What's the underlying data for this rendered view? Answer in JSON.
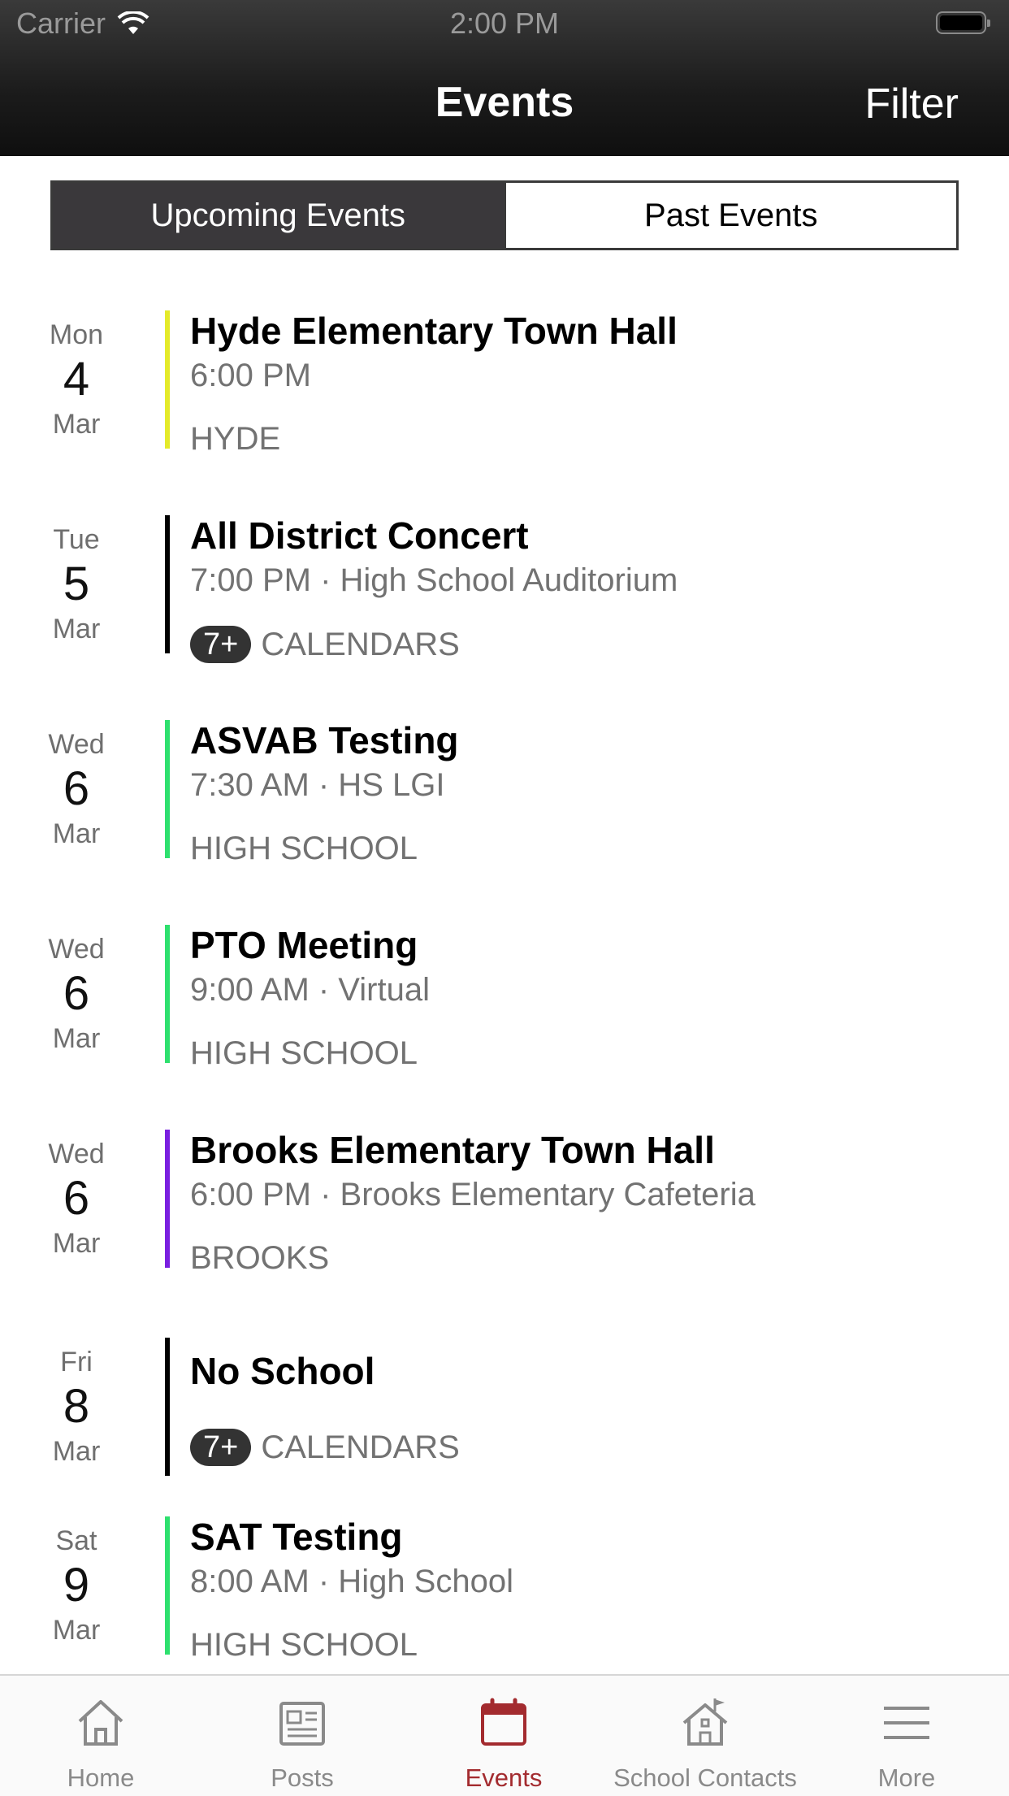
{
  "status_bar": {
    "carrier": "Carrier",
    "time": "2:00 PM"
  },
  "header": {
    "title": "Events",
    "filter": "Filter"
  },
  "segments": {
    "upcoming": "Upcoming Events",
    "past": "Past Events"
  },
  "events": [
    {
      "dow": "Mon",
      "day": "4",
      "month": "Mar",
      "title": "Hyde Elementary Town Hall",
      "time": "6:00 PM",
      "calendar": "HYDE",
      "badge": "",
      "color": "#e4ea2a"
    },
    {
      "dow": "Tue",
      "day": "5",
      "month": "Mar",
      "title": "All District Concert",
      "time": "7:00 PM · High School Auditorium",
      "calendar": "CALENDARS",
      "badge": "7+",
      "color": "#000000"
    },
    {
      "dow": "Wed",
      "day": "6",
      "month": "Mar",
      "title": "ASVAB Testing",
      "time": "7:30 AM · HS LGI",
      "calendar": "HIGH SCHOOL",
      "badge": "",
      "color": "#2ee06e"
    },
    {
      "dow": "Wed",
      "day": "6",
      "month": "Mar",
      "title": "PTO Meeting",
      "time": "9:00 AM · Virtual",
      "calendar": "HIGH SCHOOL",
      "badge": "",
      "color": "#2ee06e"
    },
    {
      "dow": "Wed",
      "day": "6",
      "month": "Mar",
      "title": "Brooks Elementary Town Hall",
      "time": "6:00 PM · Brooks Elementary Cafeteria",
      "calendar": "BROOKS",
      "badge": "",
      "color": "#7a1fe0"
    },
    {
      "dow": "Fri",
      "day": "8",
      "month": "Mar",
      "title": "No School",
      "time": "",
      "calendar": "CALENDARS",
      "badge": "7+",
      "color": "#000000"
    },
    {
      "dow": "Sat",
      "day": "9",
      "month": "Mar",
      "title": "SAT Testing",
      "time": "8:00 AM · High School",
      "calendar": "HIGH SCHOOL",
      "badge": "",
      "color": "#2ee06e"
    }
  ],
  "tabs": [
    {
      "label": "Home",
      "icon": "home-icon"
    },
    {
      "label": "Posts",
      "icon": "newspaper-icon"
    },
    {
      "label": "Events",
      "icon": "calendar-icon"
    },
    {
      "label": "School Contacts",
      "icon": "school-icon"
    },
    {
      "label": "More",
      "icon": "menu-icon"
    }
  ],
  "colors": {
    "active_tab": "#a32b2f",
    "inactive_tab": "#8a8a8a",
    "segment_active": "#3a383b"
  }
}
